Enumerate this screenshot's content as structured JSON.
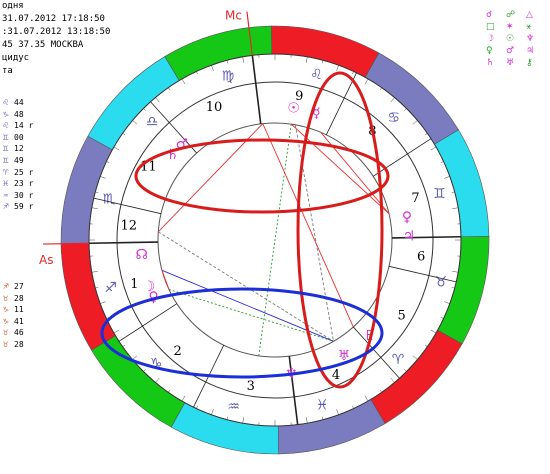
{
  "header": {
    "line1": "одня",
    "line2": " 31.07.2012 17:18:50",
    "line3": ":31.07.2012 13:18:50",
    "line4": "45 37.35 МОСКВА",
    "line5": "цидус",
    "line6": "та"
  },
  "positions_upper": [
    {
      "glyph": "♌",
      "value": "44"
    },
    {
      "glyph": "♑",
      "value": "48"
    },
    {
      "glyph": "♌",
      "value": "14 r"
    },
    {
      "glyph": "♊",
      "value": "00"
    },
    {
      "glyph": "♊",
      "value": "12"
    },
    {
      "glyph": "♊",
      "value": "49"
    },
    {
      "glyph": "♈",
      "value": "25 r"
    },
    {
      "glyph": "♓",
      "value": "23 r"
    },
    {
      "glyph": "♒",
      "value": "30 r"
    },
    {
      "glyph": "♐",
      "value": "59 r"
    }
  ],
  "positions_lower": [
    {
      "glyph": "♐",
      "value": "27"
    },
    {
      "glyph": "♉",
      "value": "28"
    },
    {
      "glyph": "♑",
      "value": "11"
    },
    {
      "glyph": "♑",
      "value": "41"
    },
    {
      "glyph": "♉",
      "value": "46"
    },
    {
      "glyph": "♉",
      "value": "28"
    }
  ],
  "legend": [
    [
      "☌",
      "☍",
      "△"
    ],
    [
      "□",
      "✶",
      "⚹"
    ],
    [
      "☽",
      "☉",
      "♆"
    ],
    [
      "♀",
      "♂",
      "♃"
    ],
    [
      "♄",
      "♅",
      "⚷"
    ]
  ],
  "chart": {
    "mc_label": "Mc",
    "as_label": "As",
    "houses": [
      "1",
      "2",
      "3",
      "4",
      "5",
      "6",
      "7",
      "8",
      "9",
      "10",
      "11",
      "12"
    ],
    "zodiac_glyphs": [
      "♈",
      "♉",
      "♊",
      "♋",
      "♌",
      "♍",
      "♎",
      "♏",
      "♐",
      "♑",
      "♒",
      "♓"
    ],
    "planets": [
      {
        "glyph": "☉",
        "name": "sun"
      },
      {
        "glyph": "☿",
        "name": "mercury"
      },
      {
        "glyph": "♀",
        "name": "venus"
      },
      {
        "glyph": "♂",
        "name": "mars"
      },
      {
        "glyph": "♃",
        "name": "jupiter"
      },
      {
        "glyph": "♄",
        "name": "saturn"
      },
      {
        "glyph": "♅",
        "name": "uranus"
      },
      {
        "glyph": "♆",
        "name": "neptune"
      },
      {
        "glyph": "♇",
        "name": "pluto"
      },
      {
        "glyph": "☽",
        "name": "moon"
      },
      {
        "glyph": "☊",
        "name": "node"
      },
      {
        "glyph": "♀",
        "name": "venus-2"
      }
    ],
    "sign_colors": {
      "fire": "#ee1c24",
      "earth": "#16c816",
      "air": "#2bdcee",
      "water": "#7b7bbf"
    },
    "highlight_red": "#d81c1c",
    "highlight_blue": "#1b2ed8"
  }
}
